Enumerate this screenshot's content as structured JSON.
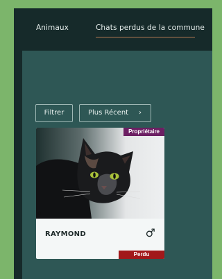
{
  "tabs": [
    {
      "label": "Animaux"
    },
    {
      "label": "Chats perdus de la commune"
    }
  ],
  "toolbar": {
    "filter_label": "Filtrer",
    "sort_label": "Plus Récent",
    "sort_icon": "chevron-right-icon"
  },
  "card": {
    "owner_badge": "Propriétaire",
    "name": "RAYMOND",
    "gender_symbol": "♂",
    "status": "Perdu",
    "copyright_mark": "©"
  },
  "colors": {
    "page_background": "#7cb56b",
    "app_background": "#162a2a",
    "panel_background": "#2e5755",
    "tab_underline": "#b77b53",
    "owner_badge": "#6c1f63",
    "status_badge": "#a2181a"
  }
}
